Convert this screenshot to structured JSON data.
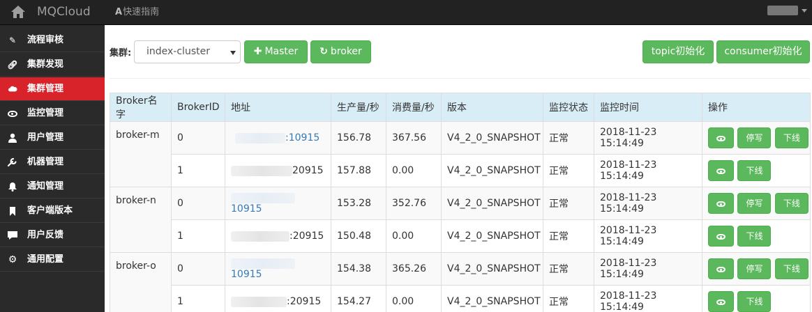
{
  "topbar": {
    "brand": "MQCloud",
    "guide_icon": "A",
    "guide": "快速指南",
    "user_icon": "user-avatar-icon"
  },
  "sidebar": {
    "items": [
      {
        "label": "流程审核",
        "icon": "pencil-icon",
        "active": false
      },
      {
        "label": "集群发现",
        "icon": "link-icon",
        "active": false
      },
      {
        "label": "集群管理",
        "icon": "cloud-icon",
        "active": true
      },
      {
        "label": "监控管理",
        "icon": "eye-icon",
        "active": false
      },
      {
        "label": "用户管理",
        "icon": "user-icon",
        "active": false
      },
      {
        "label": "机器管理",
        "icon": "wrench-icon",
        "active": false
      },
      {
        "label": "通知管理",
        "icon": "bell-icon",
        "active": false
      },
      {
        "label": "客户端版本",
        "icon": "bookmark-icon",
        "active": false
      },
      {
        "label": "用户反馈",
        "icon": "comment-icon",
        "active": false
      },
      {
        "label": "通用配置",
        "icon": "gear-icon",
        "active": false
      }
    ]
  },
  "toolbar": {
    "cluster_label": "集群:",
    "cluster_value": "index-cluster",
    "master_label": "Master",
    "broker_label": "broker",
    "topic_init_label": "topic初始化",
    "consumer_init_label": "consumer初始化"
  },
  "table": {
    "headers": [
      "Broker名字",
      "BrokerID",
      "地址",
      "生产量/秒",
      "消费量/秒",
      "版本",
      "监控状态",
      "监控时间",
      "操作"
    ],
    "groups": [
      {
        "name": "broker-m",
        "rows": [
          {
            "id": "0",
            "addr_suffix": ":10915",
            "produce": "156.78",
            "consume": "367.56",
            "version": "V4_2_0_SNAPSHOT",
            "status": "正常",
            "time": "2018-11-23 15:14:49",
            "master": true
          },
          {
            "id": "1",
            "addr_suffix": "20915",
            "produce": "157.88",
            "consume": "0.00",
            "version": "V4_2_0_SNAPSHOT",
            "status": "正常",
            "time": "2018-11-23 15:14:49",
            "master": false
          }
        ]
      },
      {
        "name": "broker-n",
        "rows": [
          {
            "id": "0",
            "addr_suffix": "10915",
            "produce": "153.28",
            "consume": "352.76",
            "version": "V4_2_0_SNAPSHOT",
            "status": "正常",
            "time": "2018-11-23 15:14:49",
            "master": true
          },
          {
            "id": "1",
            "addr_suffix": ":20915",
            "produce": "150.48",
            "consume": "0.00",
            "version": "V4_2_0_SNAPSHOT",
            "status": "正常",
            "time": "2018-11-23 15:14:49",
            "master": false
          }
        ]
      },
      {
        "name": "broker-o",
        "rows": [
          {
            "id": "0",
            "addr_suffix": "10915",
            "produce": "154.38",
            "consume": "365.26",
            "version": "V4_2_0_SNAPSHOT",
            "status": "正常",
            "time": "2018-11-23 15:14:49",
            "master": true
          },
          {
            "id": "1",
            "addr_suffix": ":20915",
            "produce": "154.27",
            "consume": "0.00",
            "version": "V4_2_0_SNAPSHOT",
            "status": "正常",
            "time": "2018-11-23 15:14:49",
            "master": false
          }
        ]
      }
    ],
    "ops": {
      "view_icon": "eye-icon",
      "stop_write_label": "停写",
      "offline_label": "下线"
    }
  },
  "colors": {
    "topbar_bg": "#222222",
    "sidebar_bg": "#2a2a2a",
    "active_item": "#d9232a",
    "button_green": "#5cb85c",
    "table_header_bg": "#d9edf7",
    "link": "#337ab7"
  }
}
